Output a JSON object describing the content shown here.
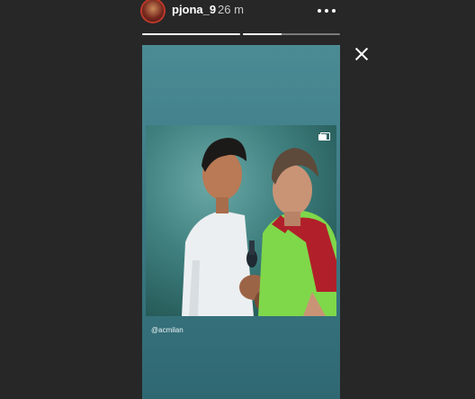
{
  "header": {
    "username": "pjona_9",
    "time": "26 m"
  },
  "progress": [
    {
      "fraction": 1.0
    },
    {
      "fraction": 0.4
    }
  ],
  "post": {
    "caption": "@acmilan",
    "stack_icon": "multiple-images-icon"
  },
  "icons": {
    "close": "close-icon",
    "more": "more-dots-icon",
    "avatar": "profile-picture"
  },
  "colors": {
    "background": "#272727",
    "story_teal": "#3d7b86",
    "progress_track": "#7a7a7a",
    "progress_fill": "#ffffff"
  }
}
